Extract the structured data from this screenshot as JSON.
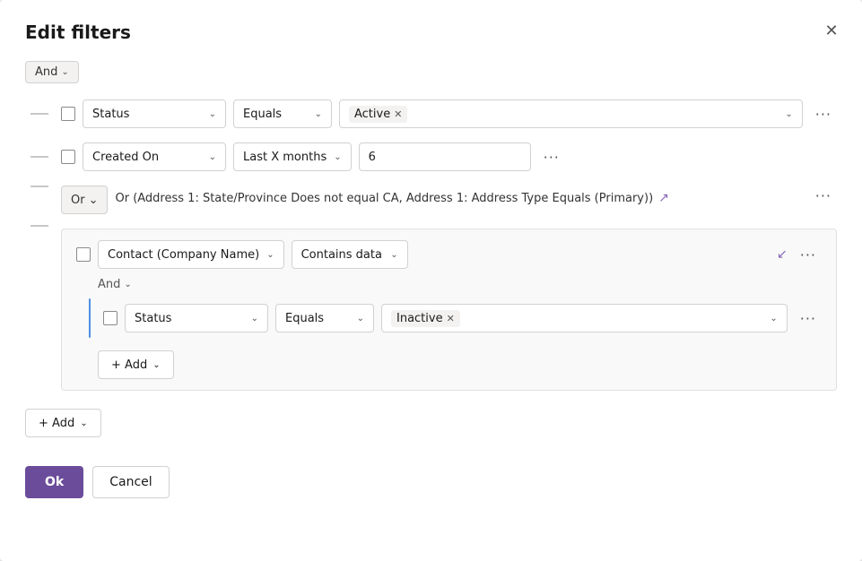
{
  "dialog": {
    "title": "Edit filters",
    "close_label": "✕"
  },
  "top_and": {
    "label": "And",
    "chevron": "⌄"
  },
  "row1": {
    "field": "Status",
    "operator": "Equals",
    "value_tag": "Active",
    "more": "···"
  },
  "row2": {
    "field": "Created On",
    "operator": "Last X months",
    "value": "6",
    "more": "···"
  },
  "or_row": {
    "badge_label": "Or",
    "badge_chevron": "⌄",
    "text": "Or (Address 1: State/Province Does not equal CA, Address 1: Address Type Equals (Primary))",
    "expand_icon": "↗",
    "more": "···"
  },
  "nested_group": {
    "field": "Contact (Company Name)",
    "operator": "Contains data",
    "collapse_icon": "↙",
    "more": "···",
    "and_label": "And",
    "and_chevron": "⌄",
    "inner_row": {
      "field": "Status",
      "operator": "Equals",
      "value_tag": "Inactive",
      "more": "···"
    },
    "add_btn": "+ Add",
    "add_chevron": "⌄"
  },
  "bottom_add": {
    "label": "+ Add",
    "chevron": "⌄"
  },
  "footer": {
    "ok_label": "Ok",
    "cancel_label": "Cancel"
  }
}
